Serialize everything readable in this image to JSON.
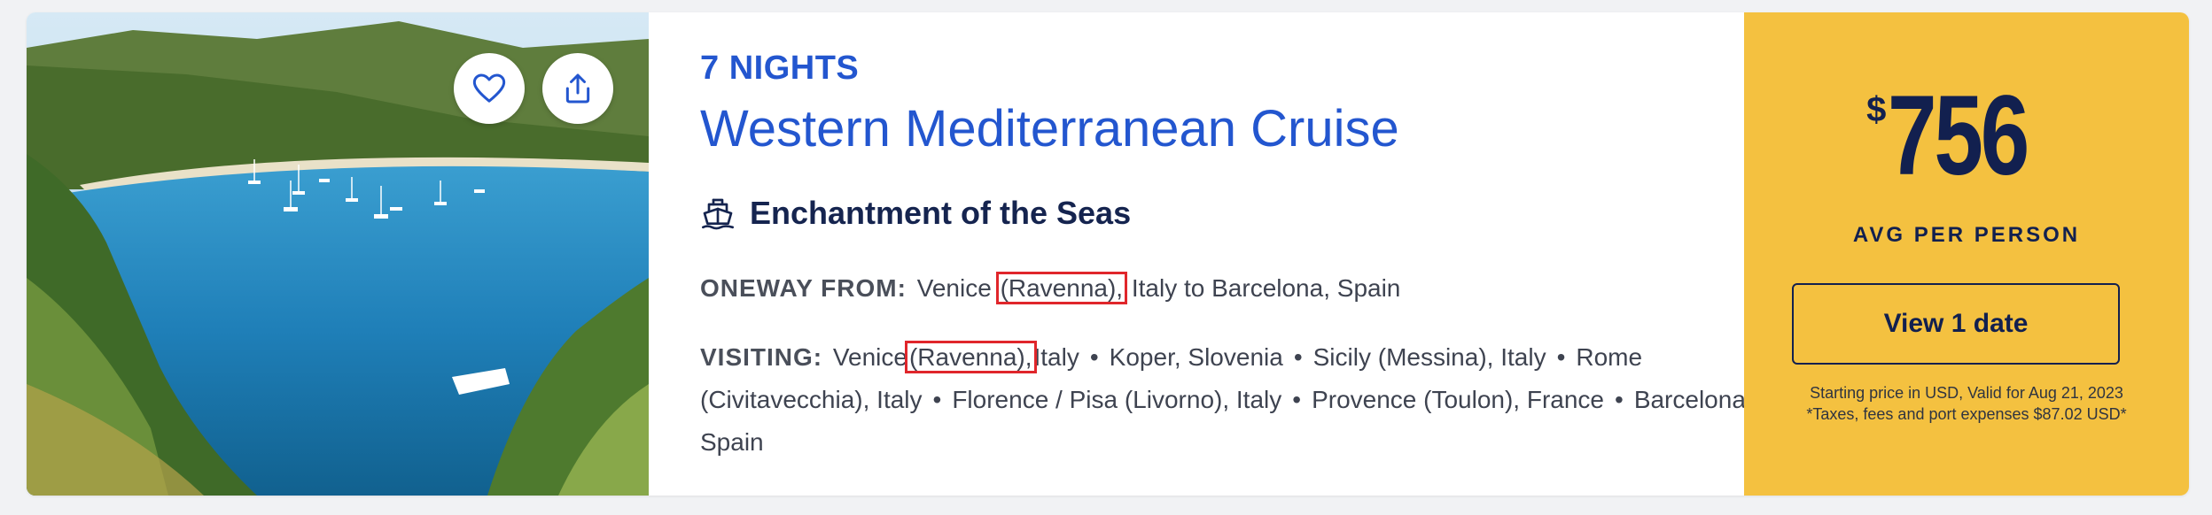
{
  "photo": {
    "alt": "Mediterranean bay with sailboats",
    "favorite_icon": "heart-icon",
    "share_icon": "share-icon"
  },
  "itinerary": {
    "nights": "7 NIGHTS",
    "title": "Western Mediterranean Cruise",
    "ship_icon": "ship-icon",
    "ship_name": "Enchantment of the Seas",
    "route_label": "ONEWAY FROM:",
    "route_from_city": "Venice",
    "route_from_highlight": "(Ravenna),",
    "route_rest": "Italy to Barcelona, Spain",
    "visiting_label": "VISITING:",
    "visiting_first_city": "Venice",
    "visiting_first_highlight": "(Ravenna),",
    "visiting_first_rest": "Italy",
    "visiting_ports": [
      "Koper, Slovenia",
      "Sicily (Messina), Italy",
      "Rome (Civitavecchia), Italy",
      "Florence / Pisa (Livorno), Italy",
      "Provence (Toulon), France",
      "Barcelona, Spain"
    ],
    "separator": "•"
  },
  "pricing": {
    "currency": "$",
    "amount": "756",
    "per_label": "AVG PER PERSON",
    "cta_label": "View 1 date",
    "fine_print_1": "Starting price in USD, Valid for Aug 21, 2023",
    "fine_print_2": "*Taxes, fees and port expenses $87.02 USD*"
  },
  "colors": {
    "accent_blue": "#2356cf",
    "navy": "#12204f",
    "price_panel": "#f4c140",
    "highlight_box": "#e0262b"
  }
}
